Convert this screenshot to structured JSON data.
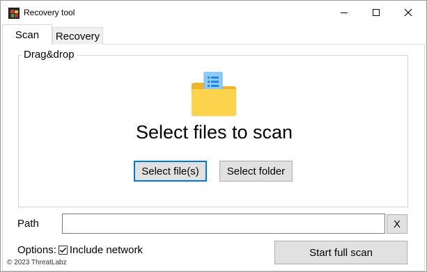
{
  "window": {
    "title": "Recovery tool"
  },
  "tabs": [
    {
      "label": "Scan",
      "active": true
    },
    {
      "label": "Recovery",
      "active": false
    }
  ],
  "dropzone": {
    "legend": "Drag&drop",
    "heading": "Select files to scan",
    "select_files_label": "Select file(s)",
    "select_folder_label": "Select folder",
    "icon": "folder-document-icon"
  },
  "path": {
    "label": "Path",
    "value": "",
    "clear_label": "X"
  },
  "options": {
    "label": "Options:",
    "include_network_label": "Include network",
    "include_network_checked": true
  },
  "actions": {
    "start_scan_label": "Start full scan"
  },
  "footer": {
    "copyright": "© 2023 ThreatLabz"
  },
  "colors": {
    "focus_border": "#0078d7",
    "button_bg": "#e1e1e1",
    "folder_yellow": "#f8c843",
    "document_blue": "#90caf9"
  }
}
